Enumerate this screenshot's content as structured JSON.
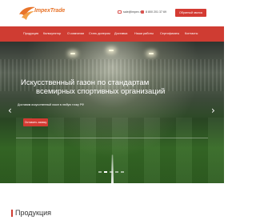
{
  "header": {
    "logo_text": "ImpexTrade",
    "logo_subtext": "IMPEX TRADE",
    "email": "sale@impex.ru",
    "phone": "8 800 201 37 69",
    "callback_label": "Обратный звонок"
  },
  "nav": {
    "items": [
      {
        "label": "Продукция"
      },
      {
        "label": "Калькулятор"
      },
      {
        "label": "О компании"
      },
      {
        "label": "Стать дилером"
      },
      {
        "label": "Доставка"
      },
      {
        "label": "Наши работы"
      },
      {
        "label": "Сертификаты"
      },
      {
        "label": "Контакты"
      }
    ]
  },
  "hero": {
    "title_line1": "Искусственный газон по стандартам",
    "title_line2": "всемирных спортивных организаций",
    "subtitle": "Доставим искусственный газон в любую точку РФ",
    "order_label": "Оставить заявку",
    "prev_glyph": "‹",
    "next_glyph": "›",
    "slide_count": 5
  },
  "section": {
    "title": "Продукция"
  },
  "colors": {
    "accent": "#cf3c32",
    "logo": "#e8742a"
  }
}
